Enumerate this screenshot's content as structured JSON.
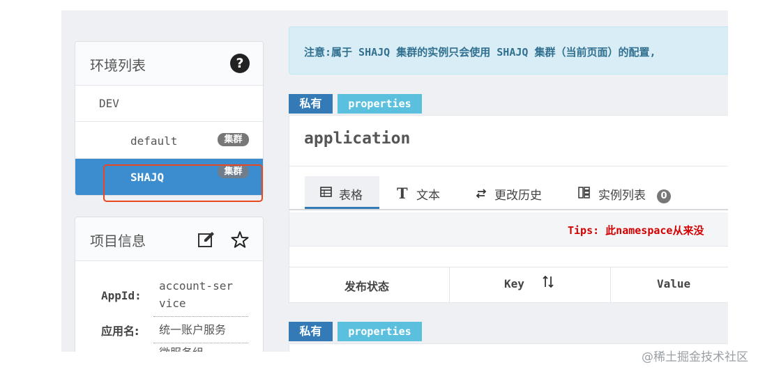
{
  "env_panel": {
    "title": "环境列表",
    "help_icon": "question-circle-icon",
    "env": "DEV",
    "clusters": [
      {
        "name": "default",
        "badge": "集群",
        "selected": false
      },
      {
        "name": "SHAJQ",
        "badge": "集群",
        "selected": true
      }
    ]
  },
  "project_panel": {
    "title": "项目信息",
    "edit_icon": "edit-icon",
    "star_icon": "star-icon",
    "appid_label": "AppId:",
    "appid_value_1": "account-ser",
    "appid_value_2": "vice",
    "appname_label": "应用名:",
    "appname_value": "统一账户服务",
    "partial_row": "微服务组"
  },
  "notice": {
    "text": "注意:属于 SHAJQ 集群的实例只会使用 SHAJQ 集群（当前页面）的配置,"
  },
  "namespace": {
    "private_label": "私有",
    "format_label": "properties",
    "title": "application",
    "tabs": [
      {
        "label": "表格",
        "icon": "table-icon",
        "active": true
      },
      {
        "label": "文本",
        "icon": "text-icon",
        "active": false
      },
      {
        "label": "更改历史",
        "icon": "history-icon",
        "active": false
      },
      {
        "label": "实例列表",
        "icon": "instance-list-icon",
        "active": false,
        "count": "0"
      }
    ],
    "tips": "Tips: 此namespace从来没",
    "columns": [
      "发布状态",
      "Key",
      "Value"
    ],
    "sort_icon": "sort-icon"
  },
  "namespace2": {
    "private_label": "私有",
    "format_label": "properties"
  },
  "watermark": "@稀土掘金技术社区",
  "colors": {
    "selected_bg": "#3c8dd0",
    "private_label": "#337ab7",
    "props_label": "#5bc0de",
    "notice_bg": "#d9edf7",
    "tips_text": "#d20000",
    "highlight": "#e8471f"
  }
}
